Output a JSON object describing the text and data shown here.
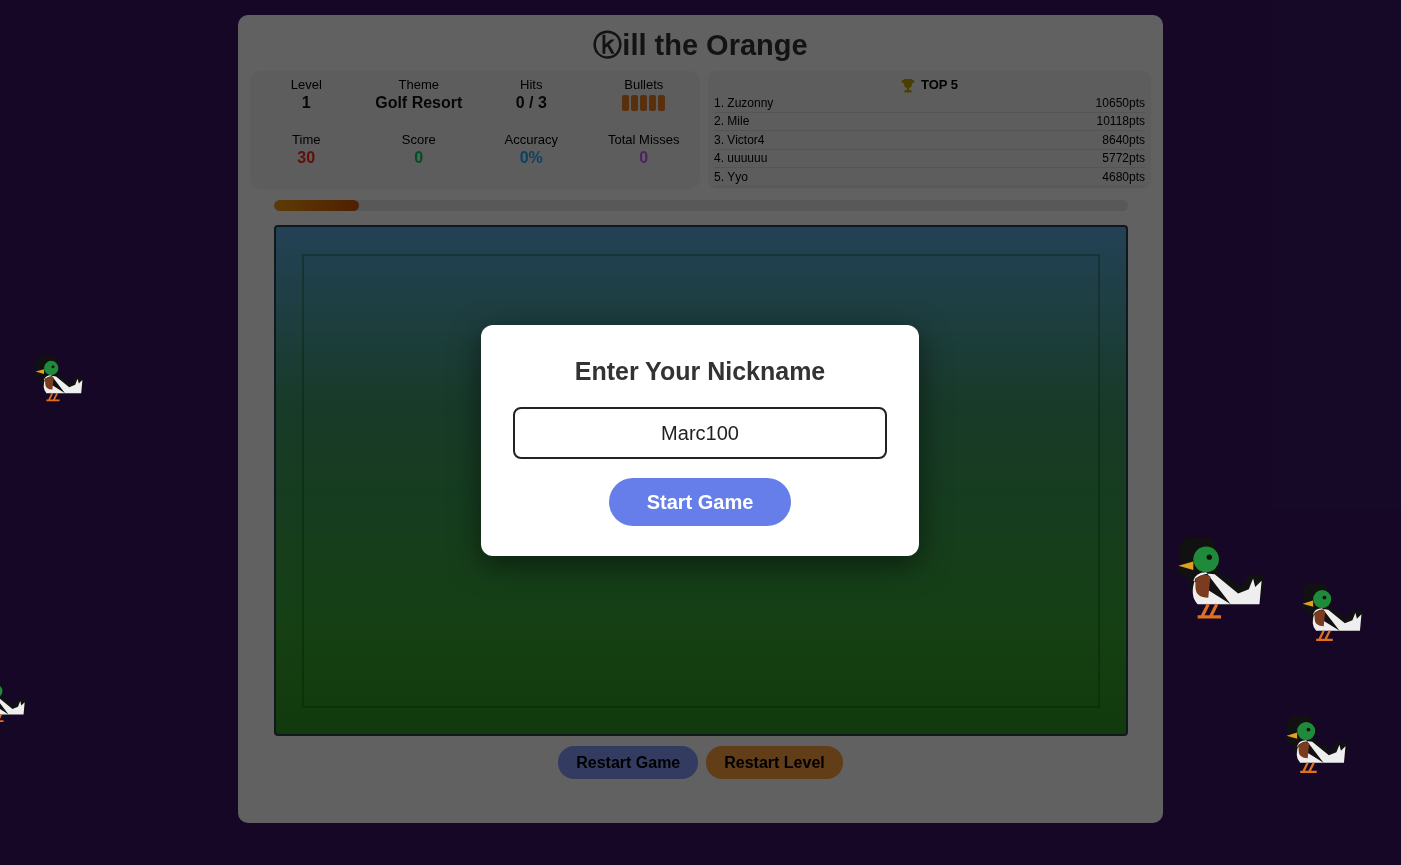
{
  "title": "ⓚill the Orange",
  "stats": [
    {
      "label": "Level",
      "value": "1",
      "kind": "plain"
    },
    {
      "label": "Theme",
      "value": "Golf Resort",
      "kind": "plain"
    },
    {
      "label": "Hits",
      "value": "0 / 3",
      "kind": "plain"
    },
    {
      "label": "Bullets",
      "kind": "bullets"
    },
    {
      "label": "Time",
      "value": "30",
      "kind": "time"
    },
    {
      "label": "Score",
      "value": "0",
      "kind": "score"
    },
    {
      "label": "Accuracy",
      "value": "0%",
      "kind": "accuracy"
    },
    {
      "label": "Total Misses",
      "value": "0",
      "kind": "misses"
    }
  ],
  "bullets": [
    {
      "loaded": true
    },
    {
      "loaded": true
    },
    {
      "loaded": true
    },
    {
      "loaded": true
    },
    {
      "loaded": true
    }
  ],
  "leaderboard": {
    "title": "TOP 5",
    "entries": [
      {
        "name": "1. Zuzonny",
        "points": "10650pts"
      },
      {
        "name": "2. Mile",
        "points": "10118pts"
      },
      {
        "name": "3. Victor4",
        "points": "8640pts"
      },
      {
        "name": "4. uuuuuu",
        "points": "5772pts"
      },
      {
        "name": "5. Yyo",
        "points": "4680pts"
      }
    ]
  },
  "progress": {
    "level": 0.1
  },
  "buttons": [
    {
      "label": "Restart Game",
      "kind": "game"
    },
    {
      "label": "Restart Level",
      "kind": "level"
    }
  ],
  "modal": {
    "title": "Enter Your Nickname",
    "value": "Marc100",
    "button": "Start Game"
  }
}
